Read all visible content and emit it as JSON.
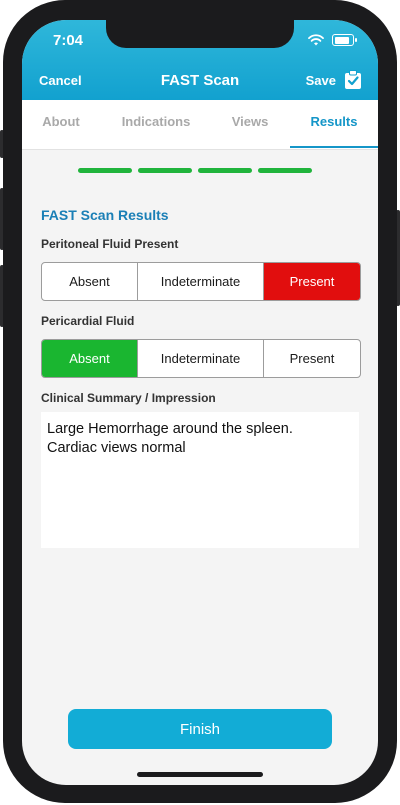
{
  "status_bar": {
    "time": "7:04"
  },
  "nav": {
    "cancel": "Cancel",
    "title": "FAST Scan",
    "save": "Save"
  },
  "tabs": [
    {
      "label": "About",
      "active": false
    },
    {
      "label": "Indications",
      "active": false
    },
    {
      "label": "Views",
      "active": false
    },
    {
      "label": "Results",
      "active": true
    }
  ],
  "progress": {
    "completed_steps": 4,
    "total_steps": 4
  },
  "results": {
    "title": "FAST Scan Results",
    "peritoneal": {
      "label": "Peritoneal Fluid Present",
      "options": [
        "Absent",
        "Indeterminate",
        "Present"
      ],
      "selected": "Present"
    },
    "pericardial": {
      "label": "Pericardial Fluid",
      "options": [
        "Absent",
        "Indeterminate",
        "Present"
      ],
      "selected": "Absent"
    },
    "summary_label": "Clinical Summary / Impression",
    "summary_text": "Large Hemorrhage around the spleen.\nCardiac views normal"
  },
  "finish_label": "Finish",
  "colors": {
    "header": "#12a1cf",
    "accent": "#1596c8",
    "progress": "#20b43c",
    "selected_red": "#e10e0e",
    "selected_green": "#1ab630",
    "finish": "#12acd6"
  }
}
